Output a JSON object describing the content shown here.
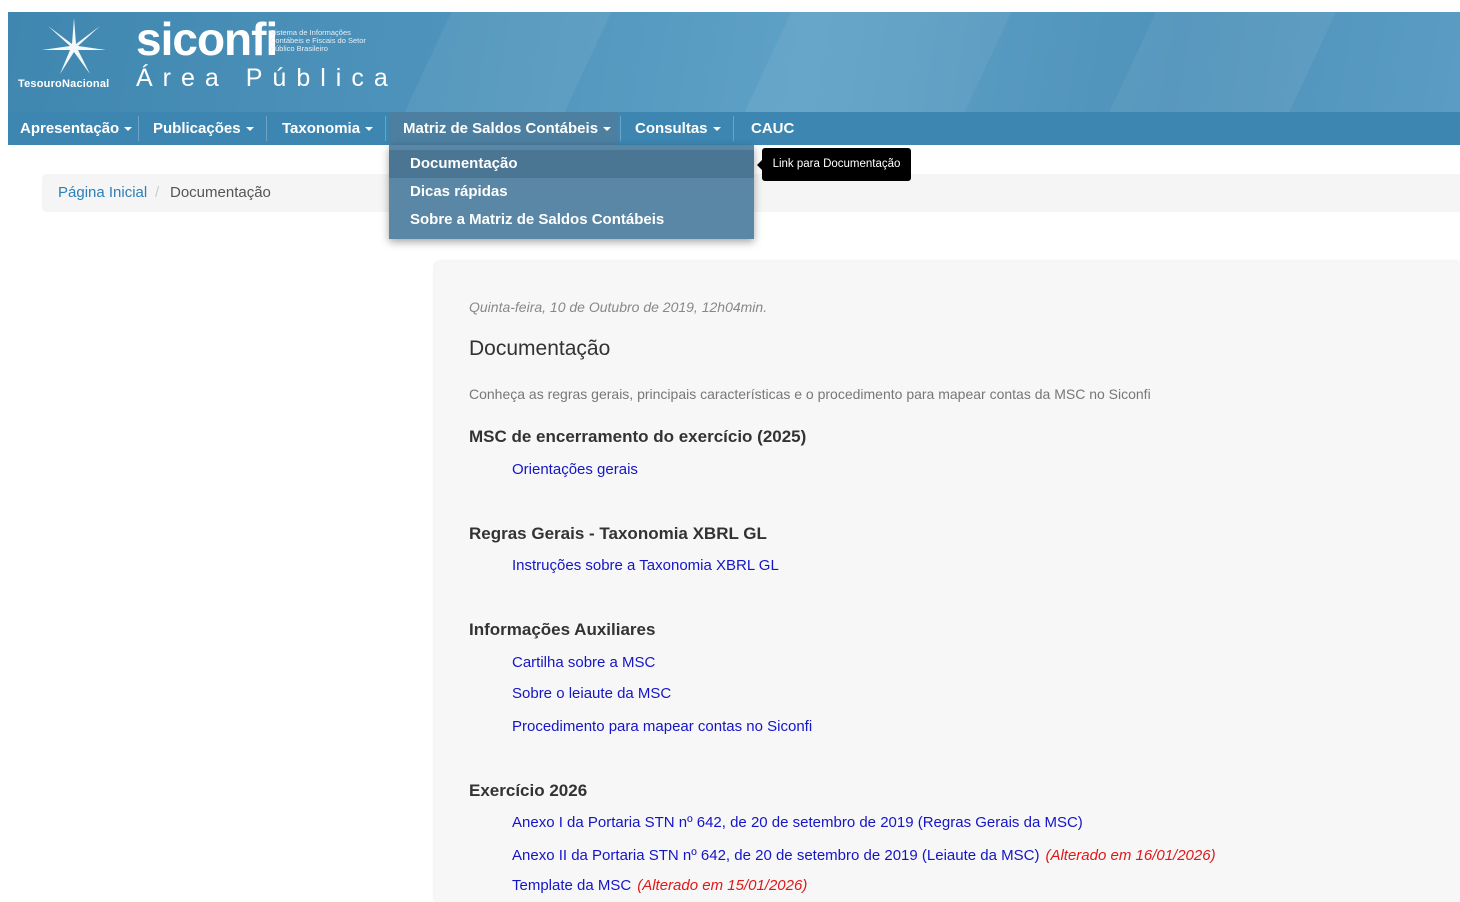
{
  "header": {
    "brand_left": "TesouroNacional",
    "siconfi": "siconfi",
    "siconfi_tagline": "Sistema de Informações Contábeis e Fiscais do Setor Público Brasileiro",
    "subtitle": "Área Pública"
  },
  "nav": {
    "items": [
      {
        "label": "Apresentação",
        "has_caret": true
      },
      {
        "label": "Publicações",
        "has_caret": true
      },
      {
        "label": "Taxonomia",
        "has_caret": true
      },
      {
        "label": "Matriz de Saldos Contábeis",
        "has_caret": true,
        "active": true
      },
      {
        "label": "Consultas",
        "has_caret": true
      },
      {
        "label": "CAUC",
        "has_caret": false
      }
    ]
  },
  "dropdown": {
    "items": [
      {
        "label": "Documentação",
        "selected": true
      },
      {
        "label": "Dicas rápidas"
      },
      {
        "label": "Sobre a Matriz de Saldos Contábeis"
      }
    ]
  },
  "tooltip": {
    "text": "Link para Documentação"
  },
  "breadcrumb": {
    "home": "Página Inicial",
    "separator": "/",
    "current": "Documentação"
  },
  "content": {
    "date": "Quinta-feira, 10 de Outubro de 2019, 12h04min.",
    "title": "Documentação",
    "description": "Conheça as regras gerais, principais características e o procedimento para mapear contas da MSC no Siconfi",
    "sections": [
      {
        "heading": "MSC de encerramento do exercício (2025)",
        "links": [
          {
            "label": "Orientações gerais"
          }
        ]
      },
      {
        "heading": "Regras Gerais - Taxonomia XBRL GL",
        "links": [
          {
            "label": "Instruções sobre a Taxonomia XBRL GL"
          }
        ]
      },
      {
        "heading": "Informações Auxiliares",
        "links": [
          {
            "label": "Cartilha sobre a MSC"
          },
          {
            "label": "Sobre o leiaute da MSC"
          },
          {
            "label": "Procedimento para mapear contas no Siconfi"
          }
        ]
      },
      {
        "heading": "Exercício 2026",
        "links": [
          {
            "label": "Anexo I da Portaria STN nº 642, de 20 de setembro de 2019 (Regras Gerais da MSC)"
          },
          {
            "label": "Anexo II da Portaria STN nº 642, de 20 de setembro de 2019 (Leiaute da MSC)",
            "note": "(Alterado em 16/01/2026)"
          },
          {
            "label": "Template da MSC",
            "note": "(Alterado em 15/01/2026)"
          }
        ]
      }
    ]
  },
  "colors": {
    "header_blue": "#4e93bb",
    "nav_blue": "#3d86b2",
    "dropdown_bg": "#5a87a5",
    "link_blue": "#1515c8",
    "note_red": "#e01818",
    "breadcrumb_link": "#2c7fb8"
  }
}
